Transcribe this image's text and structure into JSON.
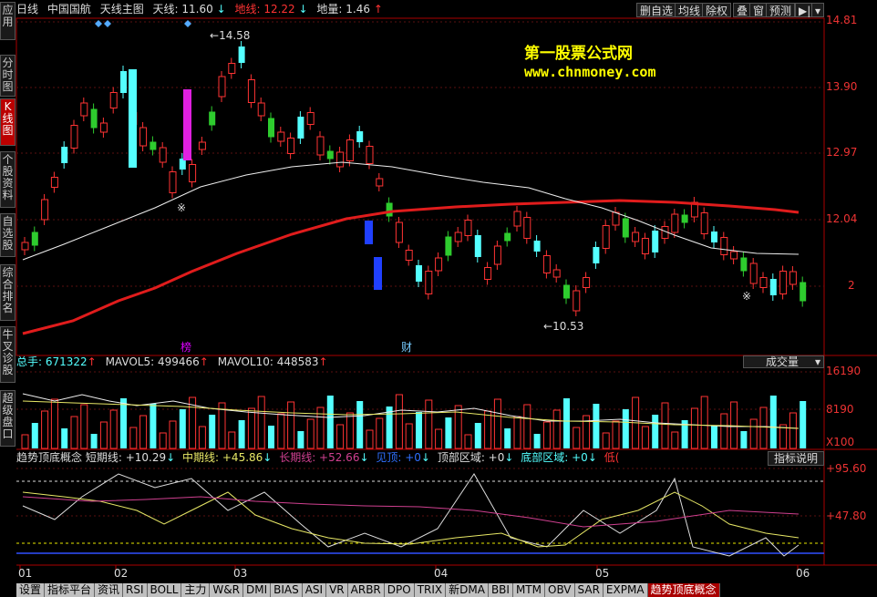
{
  "left_tabs": [
    {
      "label": "应用",
      "active": false
    },
    {
      "label": "分时图",
      "active": false
    },
    {
      "label": "K线图",
      "active": true
    },
    {
      "label": "个股资料",
      "active": false
    },
    {
      "label": "自选股",
      "active": false
    },
    {
      "label": "综合排名",
      "active": false
    },
    {
      "label": "牛叉诊股",
      "active": false
    },
    {
      "label": "超级盘口",
      "active": false
    }
  ],
  "header": {
    "period": "日线",
    "stock": "中国国航",
    "indicator": "天线主图",
    "tianxian": "天线: 11.60",
    "tianxian_arrow": "↓",
    "dixian": "地线: 12.22",
    "dixian_arrow": "↓",
    "diliang": "地量: 1.46",
    "diliang_arrow": "↑"
  },
  "toolbar": {
    "delete_watch": "删自选",
    "ma": "均线",
    "exright": "除权",
    "stack": "叠",
    "window": "窗",
    "forecast": "预测",
    "play": "▶|",
    "dropdown": "▾"
  },
  "watermark": {
    "line1": "第一股票公式网",
    "line2": "www.chnmoney.com"
  },
  "price_axis": [
    "14.81",
    "13.90",
    "12.97",
    "12.04",
    "2"
  ],
  "annotations": {
    "high": "14.58",
    "low": "10.53",
    "bang": "榜",
    "cai": "财"
  },
  "volume": {
    "zongshou": "总手: 671322",
    "mavol5": "MAVOL5: 499466",
    "mavol10": "MAVOL10: 448583",
    "selector": "成交量",
    "axis": [
      "16190",
      "8190",
      "X100"
    ]
  },
  "indicator": {
    "name": "趋势顶底概念",
    "short": "短期线: +10.29",
    "mid": "中期线: +45.86",
    "long": "长期线: +52.66",
    "jianding": "见顶: +0",
    "top_zone": "顶部区域: +0",
    "bottom_zone": "底部区域: +0",
    "di": "低(",
    "help": "指标说明",
    "axis": [
      "+95.60",
      "+47.80"
    ]
  },
  "date_axis": [
    "01",
    "02",
    "03",
    "04",
    "05",
    "06"
  ],
  "bottom_tabs": [
    "设置",
    "指标平台",
    "资讯",
    "RSI",
    "BOLL",
    "主力",
    "W&R",
    "DMI",
    "BIAS",
    "ASI",
    "VR",
    "ARBR",
    "DPO",
    "TRIX",
    "新DMA",
    "BBI",
    "MTM",
    "OBV",
    "SAR",
    "EXPMA",
    "趋势顶底概念"
  ],
  "colors": {
    "up": "#ff3333",
    "down": "#54ffff",
    "green": "#2ecc2e",
    "ma_red": "#e01c1c",
    "panel_border": "#a00000"
  }
}
